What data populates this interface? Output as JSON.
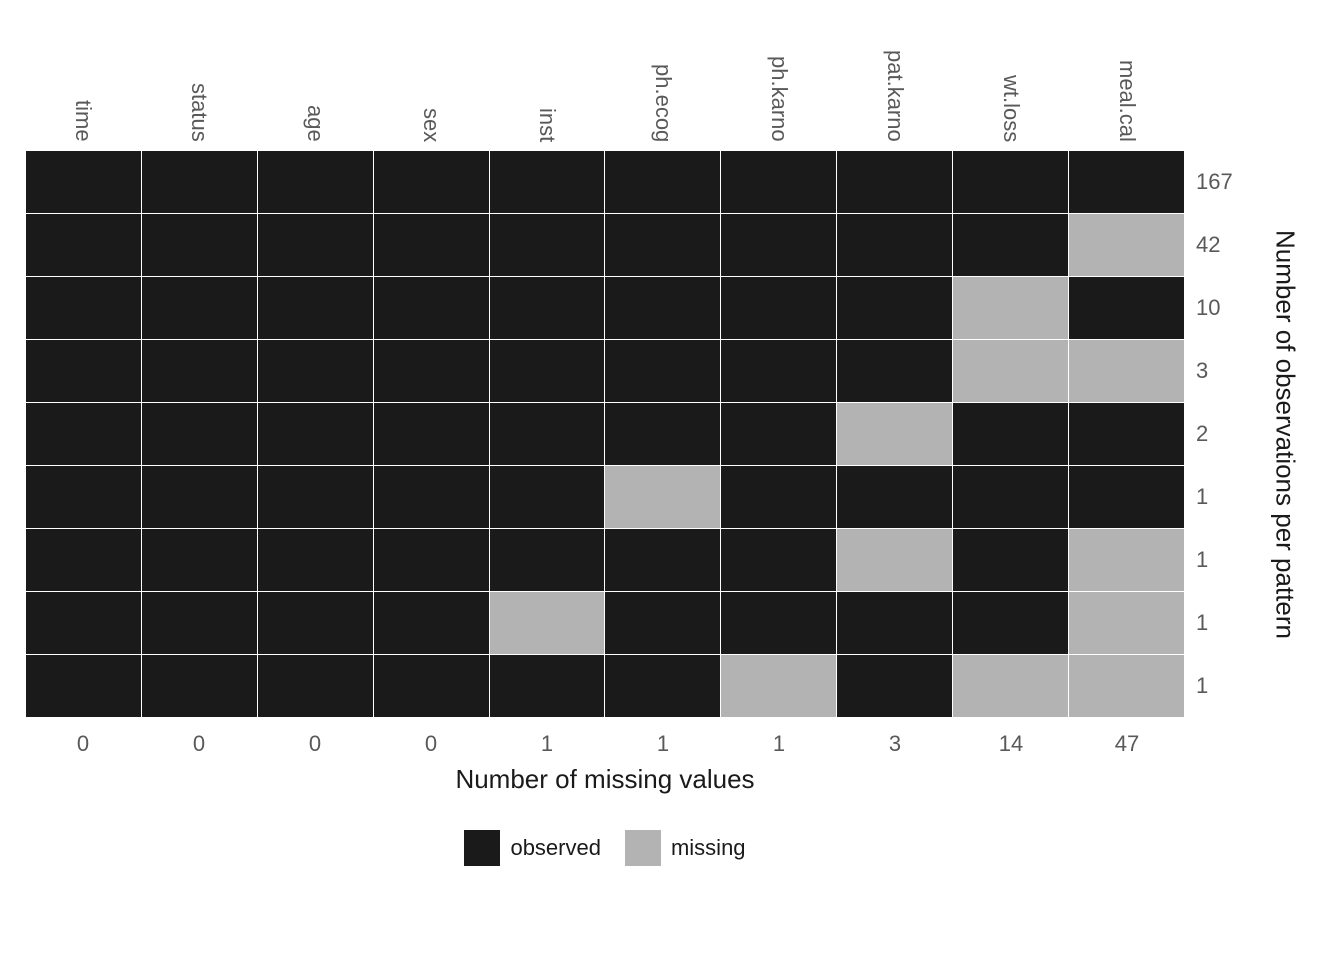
{
  "chart_data": {
    "type": "heatmap",
    "variables": [
      "time",
      "status",
      "age",
      "sex",
      "inst",
      "ph.ecog",
      "ph.karno",
      "pat.karno",
      "wt.loss",
      "meal.cal"
    ],
    "pattern_counts": [
      167,
      42,
      10,
      3,
      2,
      1,
      1,
      1,
      1
    ],
    "patterns": [
      [
        "observed",
        "observed",
        "observed",
        "observed",
        "observed",
        "observed",
        "observed",
        "observed",
        "observed",
        "observed"
      ],
      [
        "observed",
        "observed",
        "observed",
        "observed",
        "observed",
        "observed",
        "observed",
        "observed",
        "observed",
        "missing"
      ],
      [
        "observed",
        "observed",
        "observed",
        "observed",
        "observed",
        "observed",
        "observed",
        "observed",
        "missing",
        "observed"
      ],
      [
        "observed",
        "observed",
        "observed",
        "observed",
        "observed",
        "observed",
        "observed",
        "observed",
        "missing",
        "missing"
      ],
      [
        "observed",
        "observed",
        "observed",
        "observed",
        "observed",
        "observed",
        "observed",
        "missing",
        "observed",
        "observed"
      ],
      [
        "observed",
        "observed",
        "observed",
        "observed",
        "observed",
        "missing",
        "observed",
        "observed",
        "observed",
        "observed"
      ],
      [
        "observed",
        "observed",
        "observed",
        "observed",
        "observed",
        "observed",
        "observed",
        "missing",
        "observed",
        "missing"
      ],
      [
        "observed",
        "observed",
        "observed",
        "observed",
        "missing",
        "observed",
        "observed",
        "observed",
        "observed",
        "missing"
      ],
      [
        "observed",
        "observed",
        "observed",
        "observed",
        "observed",
        "observed",
        "missing",
        "observed",
        "missing",
        "missing"
      ]
    ],
    "missing_totals": [
      0,
      0,
      0,
      0,
      1,
      1,
      1,
      3,
      14,
      47
    ],
    "xlabel": "Number of missing values",
    "ylabel": "Number of observations per pattern",
    "legend": {
      "observed": {
        "label": "observed",
        "color": "#1a1a1a"
      },
      "missing": {
        "label": "missing",
        "color": "#b3b3b3"
      }
    }
  }
}
